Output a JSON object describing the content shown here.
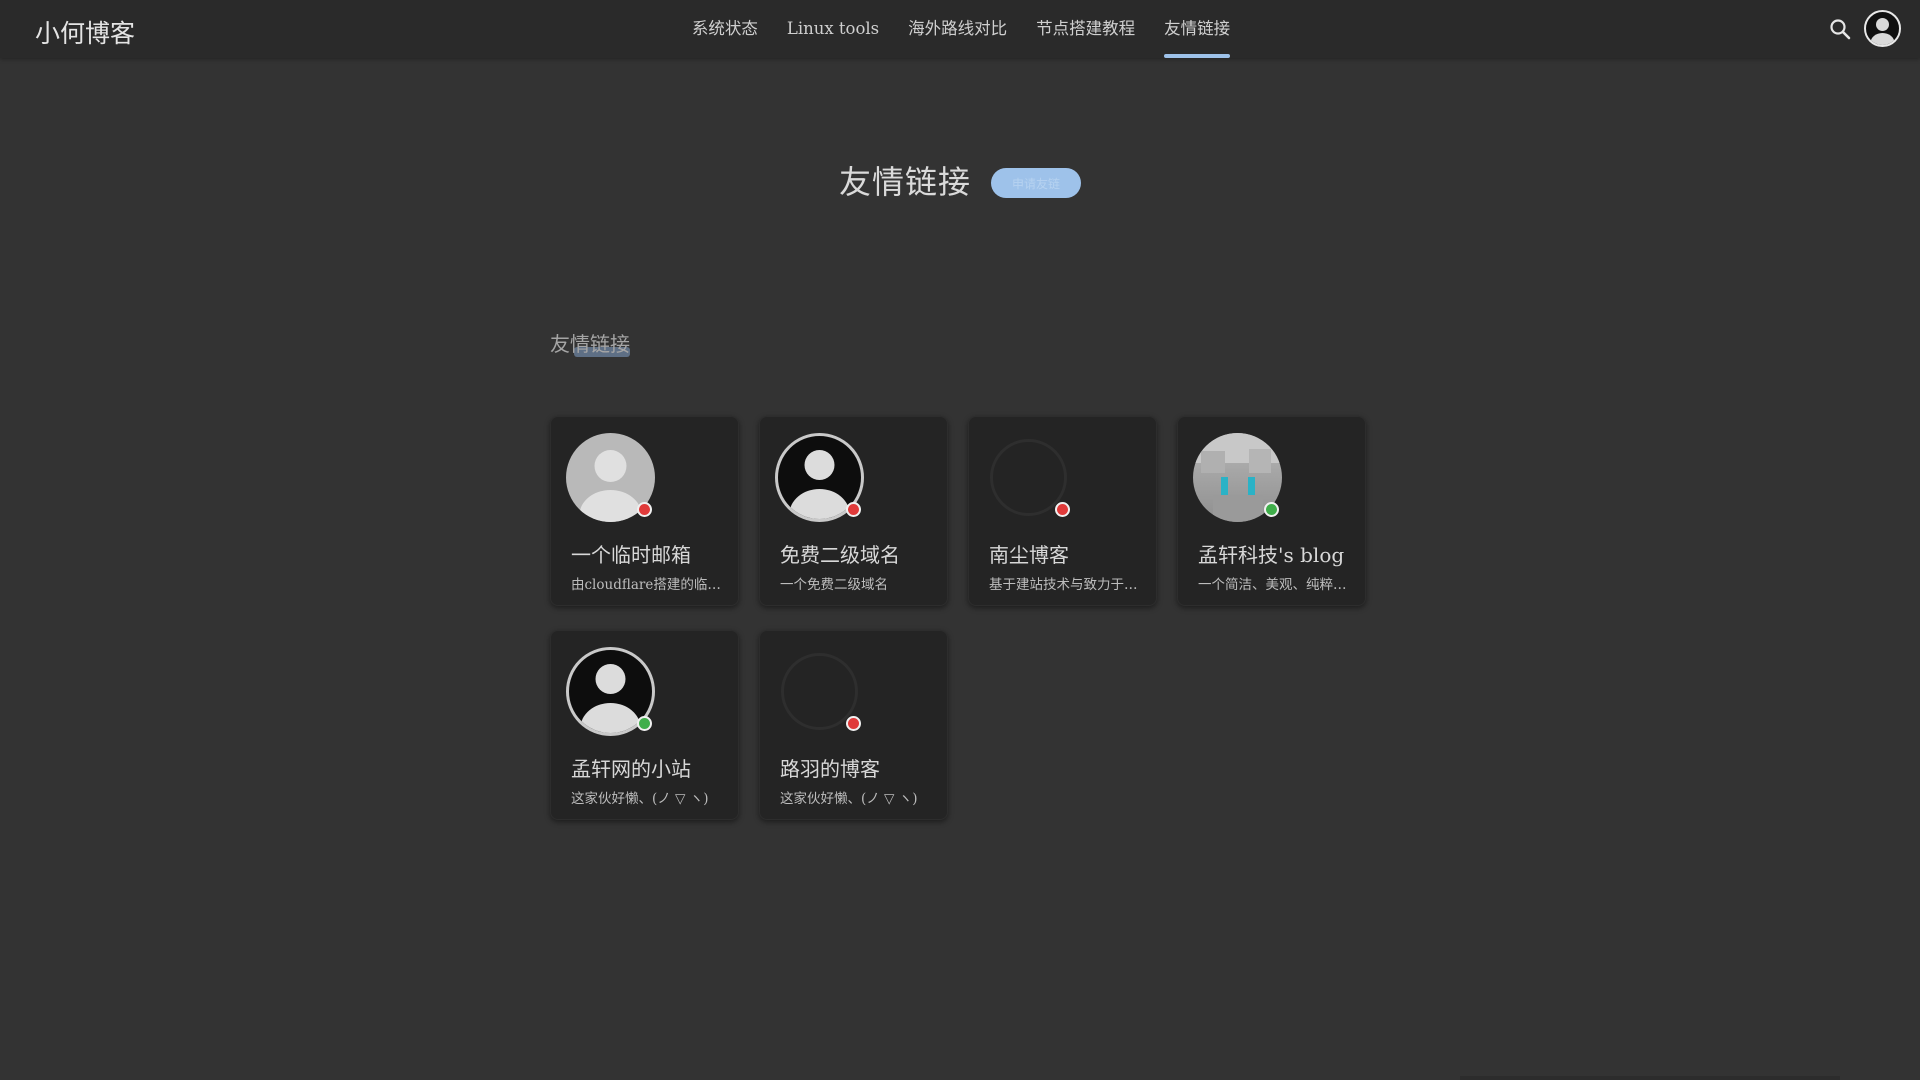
{
  "header": {
    "site_title": "小何博客",
    "nav": [
      {
        "label": "系统状态",
        "active": false
      },
      {
        "label": "Linux tools",
        "active": false
      },
      {
        "label": "海外路线对比",
        "active": false
      },
      {
        "label": "节点搭建教程",
        "active": false
      },
      {
        "label": "友情链接",
        "active": true
      }
    ],
    "search_icon": "search-icon",
    "user_icon": "user-avatar-icon"
  },
  "hero": {
    "title": "友情链接",
    "badge": "申请友链"
  },
  "section": {
    "heading": "友情链接"
  },
  "links": [
    {
      "name": "一个临时邮箱",
      "desc": "由cloudflare搭建的临时邮箱",
      "avatar": "grey-default-avatar",
      "status": "offline",
      "status_color": "#e03a3a"
    },
    {
      "name": "免费二级域名",
      "desc": "一个免费二级域名",
      "avatar": "dark-default-avatar",
      "status": "offline",
      "status_color": "#e03a3a"
    },
    {
      "name": "南尘博客",
      "desc": "基于建站技术与致力于分享",
      "avatar": "empty-avatar",
      "status": "offline",
      "status_color": "#e03a3a"
    },
    {
      "name": "孟轩科技's blog",
      "desc": "一个简洁、美观、纯粹的博客",
      "avatar": "anime-avatar",
      "status": "online",
      "status_color": "#3fae4a"
    },
    {
      "name": "孟轩网的小站",
      "desc": "这家伙好懒、(ノ ▽ ヽ)",
      "avatar": "dark-default-avatar",
      "status": "online",
      "status_color": "#3fae4a"
    },
    {
      "name": "路羽的博客",
      "desc": "这家伙好懒、(ノ ▽ ヽ)",
      "avatar": "empty-avatar",
      "status": "offline",
      "status_color": "#e03a3a"
    }
  ],
  "colors": {
    "background": "#333333",
    "header_bg": "#2a2a2a",
    "card_bg": "#242424",
    "accent": "#9ec2ea",
    "online": "#3fae4a",
    "offline": "#e03a3a"
  }
}
